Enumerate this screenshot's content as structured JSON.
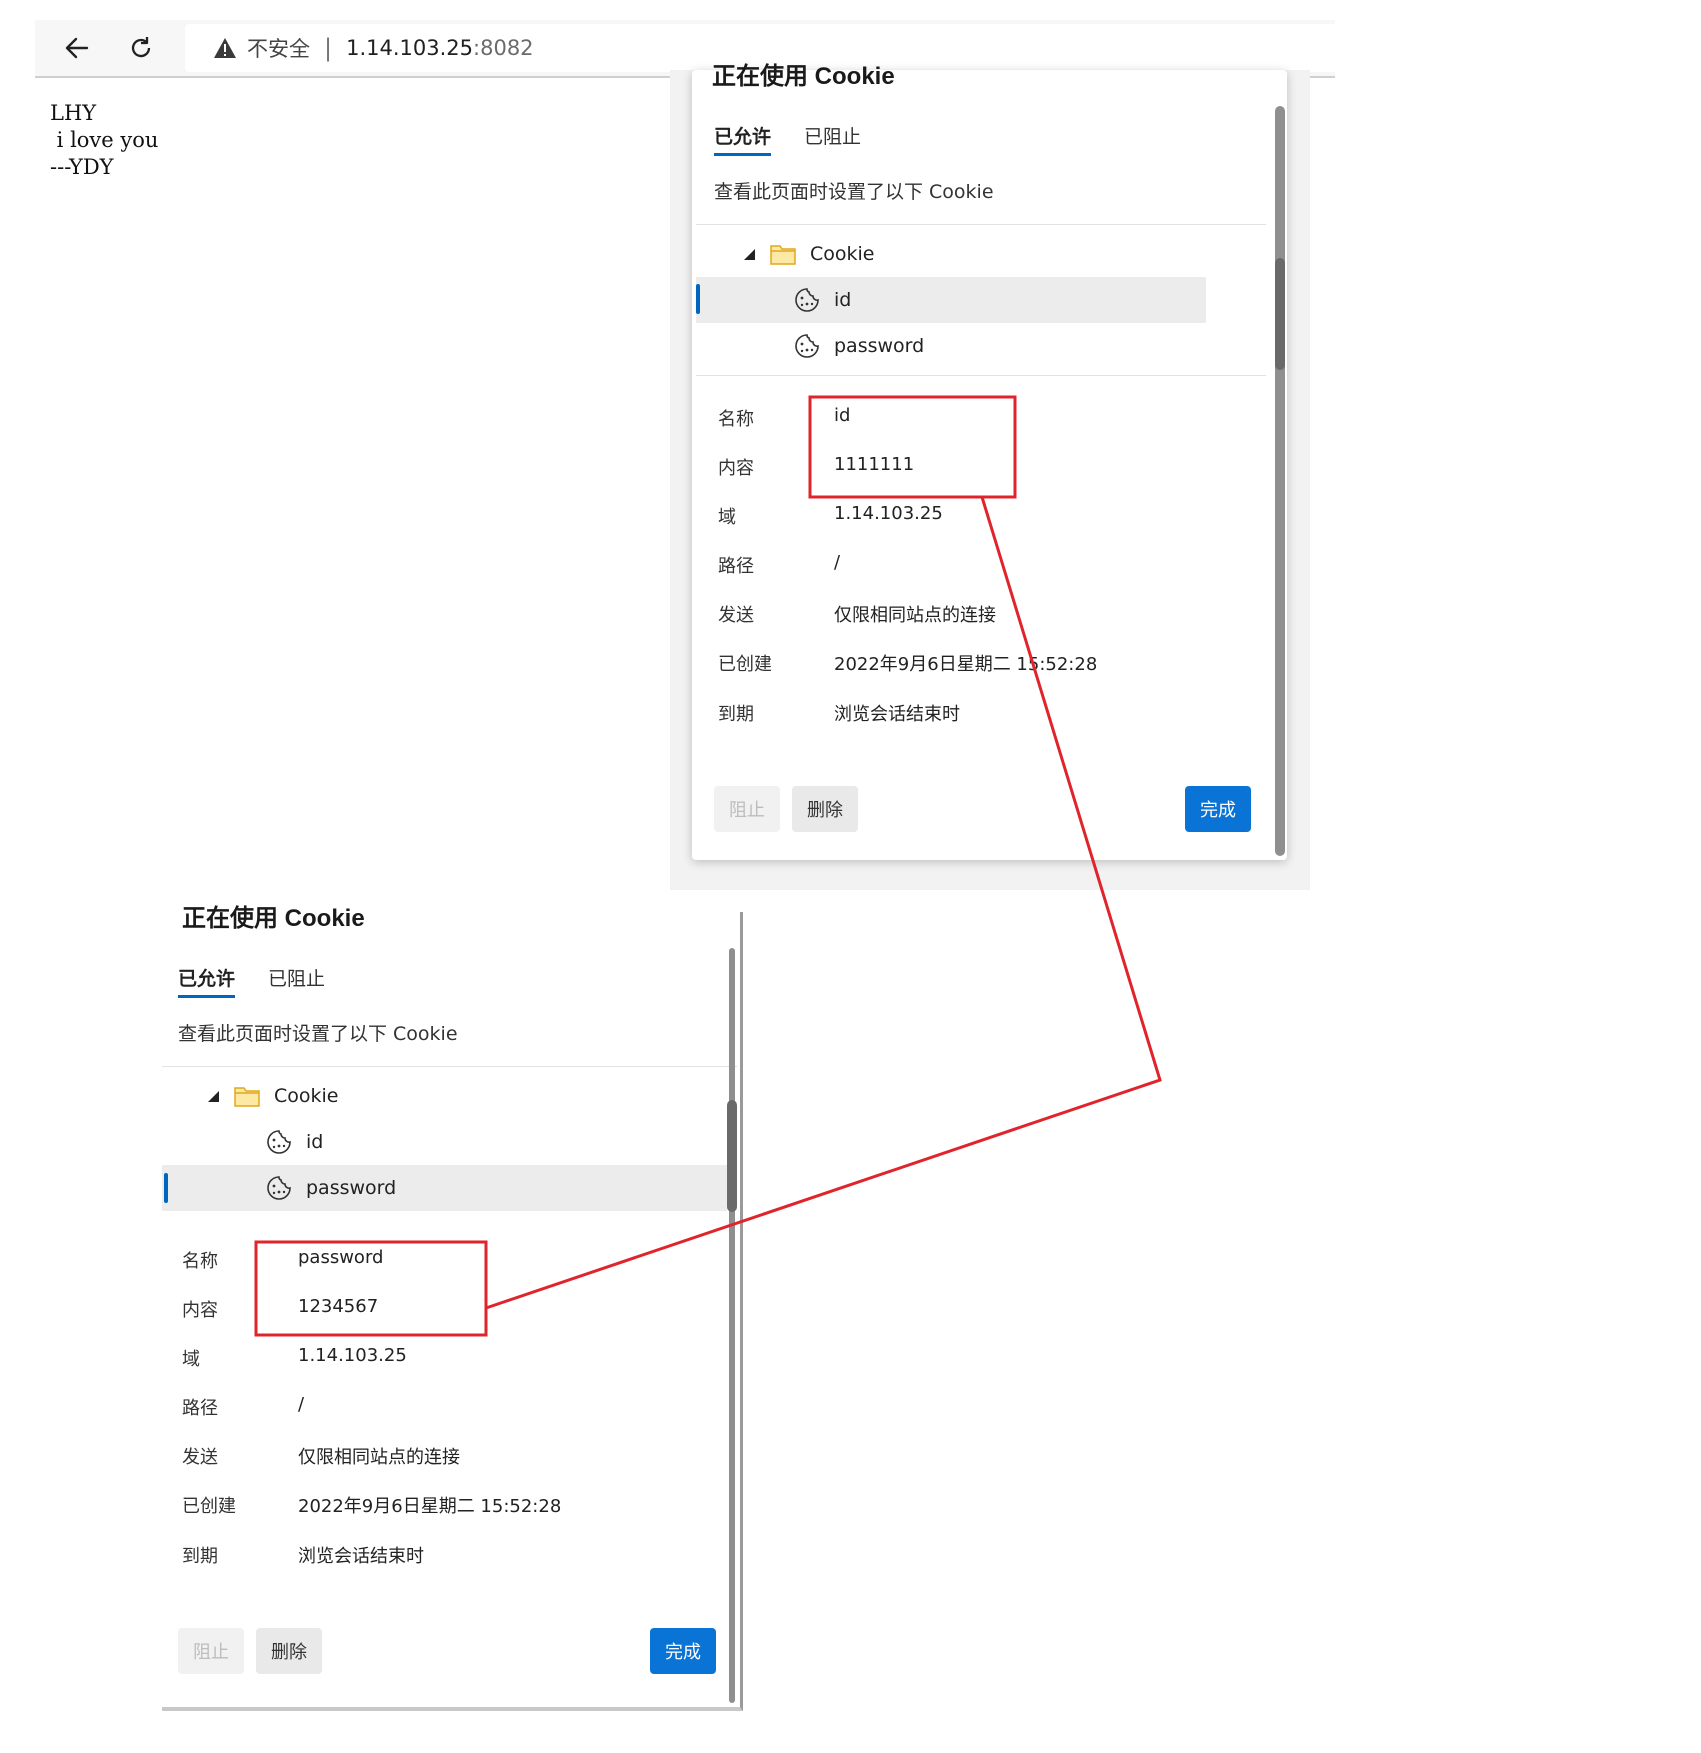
{
  "browser": {
    "security_text": "不安全",
    "separator": "|",
    "url_host": "1.14.103.25",
    "url_port": ":8082"
  },
  "page": {
    "lines": [
      "LHY",
      " i love you",
      "---YDY"
    ]
  },
  "dialog_top": {
    "title": "正在使用 Cookie",
    "tabs": [
      "已允许",
      "已阻止"
    ],
    "description": "查看此页面时设置了以下 Cookie",
    "tree": {
      "folder": "Cookie",
      "items": [
        "id",
        "password"
      ]
    },
    "details": {
      "name_label": "名称",
      "name_value": "id",
      "content_label": "内容",
      "content_value": "1111111",
      "domain_label": "域",
      "domain_value": "1.14.103.25",
      "path_label": "路径",
      "path_value": "/",
      "send_label": "发送",
      "send_value": "仅限相同站点的连接",
      "created_label": "已创建",
      "created_value": "2022年9月6日星期二 15:52:28",
      "expires_label": "到期",
      "expires_value": "浏览会话结束时"
    },
    "buttons": {
      "block": "阻止",
      "delete": "删除",
      "done": "完成"
    }
  },
  "dialog_bottom": {
    "title": "正在使用 Cookie",
    "tabs": [
      "已允许",
      "已阻止"
    ],
    "description": "查看此页面时设置了以下 Cookie",
    "tree": {
      "folder": "Cookie",
      "items": [
        "id",
        "password"
      ]
    },
    "details": {
      "name_label": "名称",
      "name_value": "password",
      "content_label": "内容",
      "content_value": "1234567",
      "domain_label": "域",
      "domain_value": "1.14.103.25",
      "path_label": "路径",
      "path_value": "/",
      "send_label": "发送",
      "send_value": "仅限相同站点的连接",
      "created_label": "已创建",
      "created_value": "2022年9月6日星期二 15:52:28",
      "expires_label": "到期",
      "expires_value": "浏览会话结束时"
    },
    "buttons": {
      "block": "阻止",
      "delete": "删除",
      "done": "完成"
    }
  },
  "colors": {
    "annotation": "#e0242b",
    "accent": "#0067c0",
    "done_button": "#0a74d6"
  },
  "icons": [
    "back-arrow-icon",
    "reload-icon",
    "warning-icon",
    "folder-icon",
    "cookie-icon",
    "expand-triangle-icon"
  ]
}
